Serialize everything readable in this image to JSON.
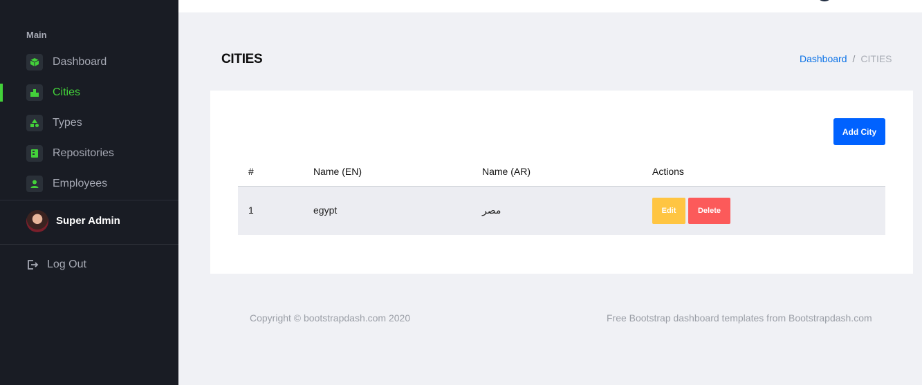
{
  "sidebar": {
    "section_label": "Main",
    "items": [
      {
        "label": "Dashboard",
        "icon": "cube-icon",
        "active": false
      },
      {
        "label": "Cities",
        "icon": "city-icon",
        "active": true
      },
      {
        "label": "Types",
        "icon": "shapes-icon",
        "active": false
      },
      {
        "label": "Repositories",
        "icon": "repository-icon",
        "active": false
      },
      {
        "label": "Employees",
        "icon": "user-icon",
        "active": false
      }
    ],
    "profile_name": "Super Admin",
    "logout_label": "Log Out"
  },
  "header": {
    "title": "CITIES",
    "breadcrumb": {
      "link": "Dashboard",
      "separator": "/",
      "current": "CITIES"
    }
  },
  "card": {
    "add_button": "Add City",
    "table": {
      "columns": [
        "#",
        "Name (EN)",
        "Name (AR)",
        "Actions"
      ],
      "rows": [
        {
          "id": "1",
          "name_en": "egypt",
          "name_ar": "مصر",
          "edit_label": "Edit",
          "delete_label": "Delete"
        }
      ]
    }
  },
  "footer": {
    "copyright": "Copyright © bootstrapdash.com 2020",
    "credit": "Free Bootstrap dashboard templates from Bootstrapdash.com"
  },
  "colors": {
    "sidebar_bg": "#191c24",
    "accent_green": "#43d13a",
    "primary": "#0062ff",
    "warning": "#ffc542",
    "danger": "#fc5a5a",
    "link": "#0b72e7"
  }
}
